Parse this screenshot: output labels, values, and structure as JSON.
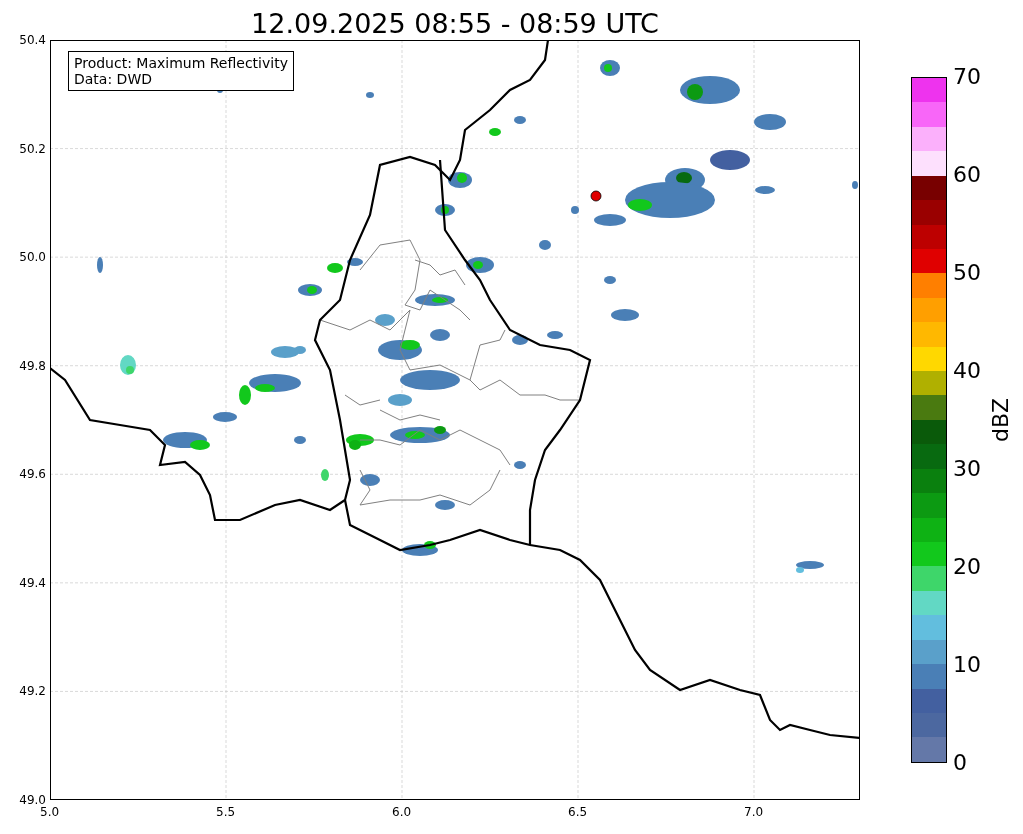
{
  "title": "12.09.2025 08:55 - 08:59 UTC",
  "info_box": [
    "Product: Maximum Reflectivity",
    "Data: DWD"
  ],
  "y_ticks": [
    "50.4",
    "50.2",
    "50.0",
    "49.8",
    "49.6",
    "49.4",
    "49.2",
    "49.0"
  ],
  "x_ticks": [
    "5.0",
    "5.5",
    "6.0",
    "6.5",
    "7.0"
  ],
  "colorbar": {
    "label": "dBZ",
    "ticks": [
      "70",
      "60",
      "50",
      "40",
      "30",
      "20",
      "10",
      "0"
    ],
    "bins": [
      {
        "color": "#ee33ee"
      },
      {
        "color": "#f866f8"
      },
      {
        "color": "#fbb0fb"
      },
      {
        "color": "#fde0fd"
      },
      {
        "color": "#780000"
      },
      {
        "color": "#9a0000"
      },
      {
        "color": "#bd0000"
      },
      {
        "color": "#e00000"
      },
      {
        "color": "#ff7f00"
      },
      {
        "color": "#ff9f00"
      },
      {
        "color": "#ffb800"
      },
      {
        "color": "#ffd800"
      },
      {
        "color": "#b0b000"
      },
      {
        "color": "#4a7a10"
      },
      {
        "color": "#0a5a0a"
      },
      {
        "color": "#086a10"
      },
      {
        "color": "#0a800e"
      },
      {
        "color": "#0c9a12"
      },
      {
        "color": "#0eb214"
      },
      {
        "color": "#12c81c"
      },
      {
        "color": "#3ed66a"
      },
      {
        "color": "#62d8c4"
      },
      {
        "color": "#62bede"
      },
      {
        "color": "#5aa0ca"
      },
      {
        "color": "#4a7fb6"
      },
      {
        "color": "#4360a0"
      },
      {
        "color": "#4c68a0"
      },
      {
        "color": "#6478a8"
      }
    ]
  }
}
